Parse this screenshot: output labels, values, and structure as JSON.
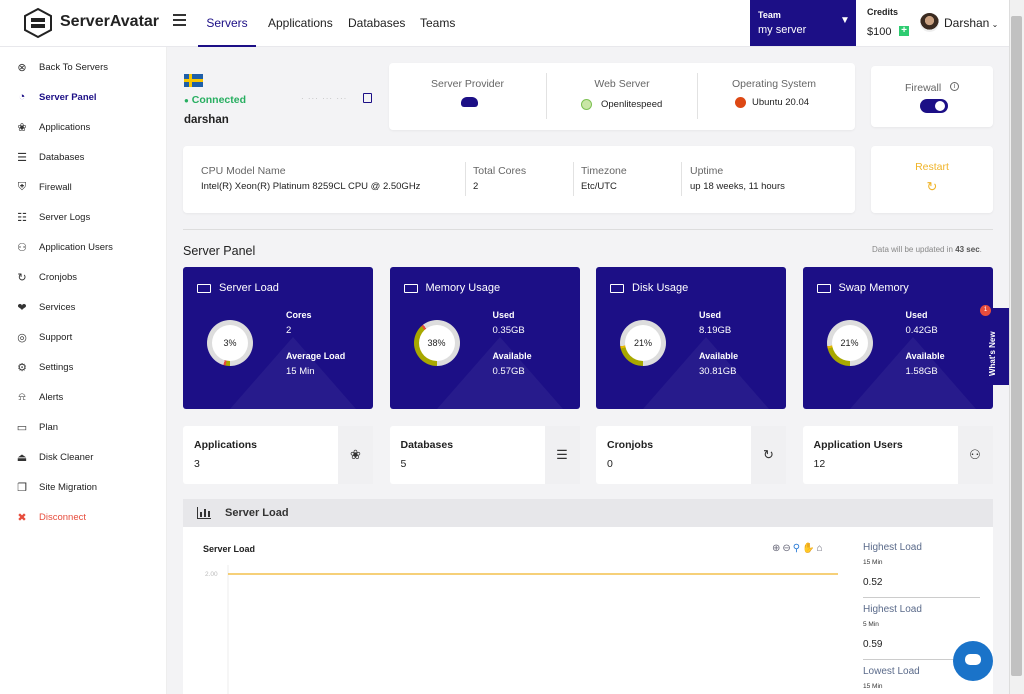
{
  "brand": {
    "name": "ServerAvatar"
  },
  "nav": {
    "servers": "Servers",
    "applications": "Applications",
    "databases": "Databases",
    "teams": "Teams"
  },
  "team": {
    "label": "Team",
    "value": "my server"
  },
  "credits": {
    "label": "Credits",
    "value": "$100"
  },
  "user": {
    "name": "Darshan"
  },
  "sidebar": {
    "items": [
      {
        "label": "Back To Servers",
        "icon": "back-circle-icon"
      },
      {
        "label": "Server Panel",
        "icon": "dashboard-icon"
      },
      {
        "label": "Applications",
        "icon": "apps-icon"
      },
      {
        "label": "Databases",
        "icon": "database-icon"
      },
      {
        "label": "Firewall",
        "icon": "shield-icon"
      },
      {
        "label": "Server Logs",
        "icon": "log-file-icon"
      },
      {
        "label": "Application Users",
        "icon": "users-icon"
      },
      {
        "label": "Cronjobs",
        "icon": "cron-icon"
      },
      {
        "label": "Services",
        "icon": "services-icon"
      },
      {
        "label": "Support",
        "icon": "support-icon"
      },
      {
        "label": "Settings",
        "icon": "gear-icon"
      },
      {
        "label": "Alerts",
        "icon": "bell-icon"
      },
      {
        "label": "Plan",
        "icon": "card-icon"
      },
      {
        "label": "Disk Cleaner",
        "icon": "disk-icon"
      },
      {
        "label": "Site Migration",
        "icon": "copy-icon"
      },
      {
        "label": "Disconnect",
        "icon": "trash-icon"
      }
    ]
  },
  "server": {
    "status": "Connected",
    "name": "darshan",
    "ip": "· ··· ··· ···"
  },
  "info": {
    "provider_label": "Server Provider",
    "webserver_label": "Web Server",
    "webserver": "Openlitespeed",
    "os_label": "Operating System",
    "os": "Ubuntu 20.04"
  },
  "firewall": {
    "label": "Firewall"
  },
  "specs": {
    "cpu_label": "CPU Model Name",
    "cpu": "Intel(R) Xeon(R) Platinum 8259CL CPU @ 2.50GHz",
    "cores_label": "Total Cores",
    "cores": "2",
    "tz_label": "Timezone",
    "tz": "Etc/UTC",
    "uptime_label": "Uptime",
    "uptime": "up 18 weeks, 11 hours"
  },
  "restart": {
    "label": "Restart"
  },
  "panel": {
    "title": "Server Panel",
    "update_prefix": "Data will be updated in",
    "update_value": "43 sec",
    "update_suffix": "."
  },
  "stats": [
    {
      "title": "Server Load",
      "pct": "3%",
      "k1": "Cores",
      "v1": "2",
      "k2": "Average Load",
      "v2": "15 Min",
      "fill": 3
    },
    {
      "title": "Memory Usage",
      "pct": "38%",
      "k1": "Used",
      "v1": "0.35GB",
      "k2": "Available",
      "v2": "0.57GB",
      "fill": 38
    },
    {
      "title": "Disk Usage",
      "pct": "21%",
      "k1": "Used",
      "v1": "8.19GB",
      "k2": "Available",
      "v2": "30.81GB",
      "fill": 21
    },
    {
      "title": "Swap Memory",
      "pct": "21%",
      "k1": "Used",
      "v1": "0.42GB",
      "k2": "Available",
      "v2": "1.58GB",
      "fill": 21
    }
  ],
  "whatsnew": {
    "label": "What's New",
    "badge": "1"
  },
  "counts": [
    {
      "name": "Applications",
      "count": "3",
      "icon": "apps-icon"
    },
    {
      "name": "Databases",
      "count": "5",
      "icon": "database-icon"
    },
    {
      "name": "Cronjobs",
      "count": "0",
      "icon": "refresh-icon"
    },
    {
      "name": "Application Users",
      "count": "12",
      "icon": "users-icon"
    }
  ],
  "load_section": {
    "title": "Server Load"
  },
  "chart_data": {
    "type": "line",
    "title": "Server Load",
    "ytick": "2.00",
    "series": [
      {
        "values": [
          2.0,
          2.0
        ]
      }
    ]
  },
  "load_stats": [
    {
      "label": "Highest Load",
      "period": "15 Min",
      "value": "0.52"
    },
    {
      "label": "Highest Load",
      "period": "5 Min",
      "value": "0.59"
    },
    {
      "label": "Lowest Load",
      "period": "15 Min",
      "value": ""
    }
  ],
  "colors": {
    "primary": "#1c0f86",
    "accent": "#f0b429",
    "success": "#2ecc71",
    "danger": "#e74c3c"
  }
}
